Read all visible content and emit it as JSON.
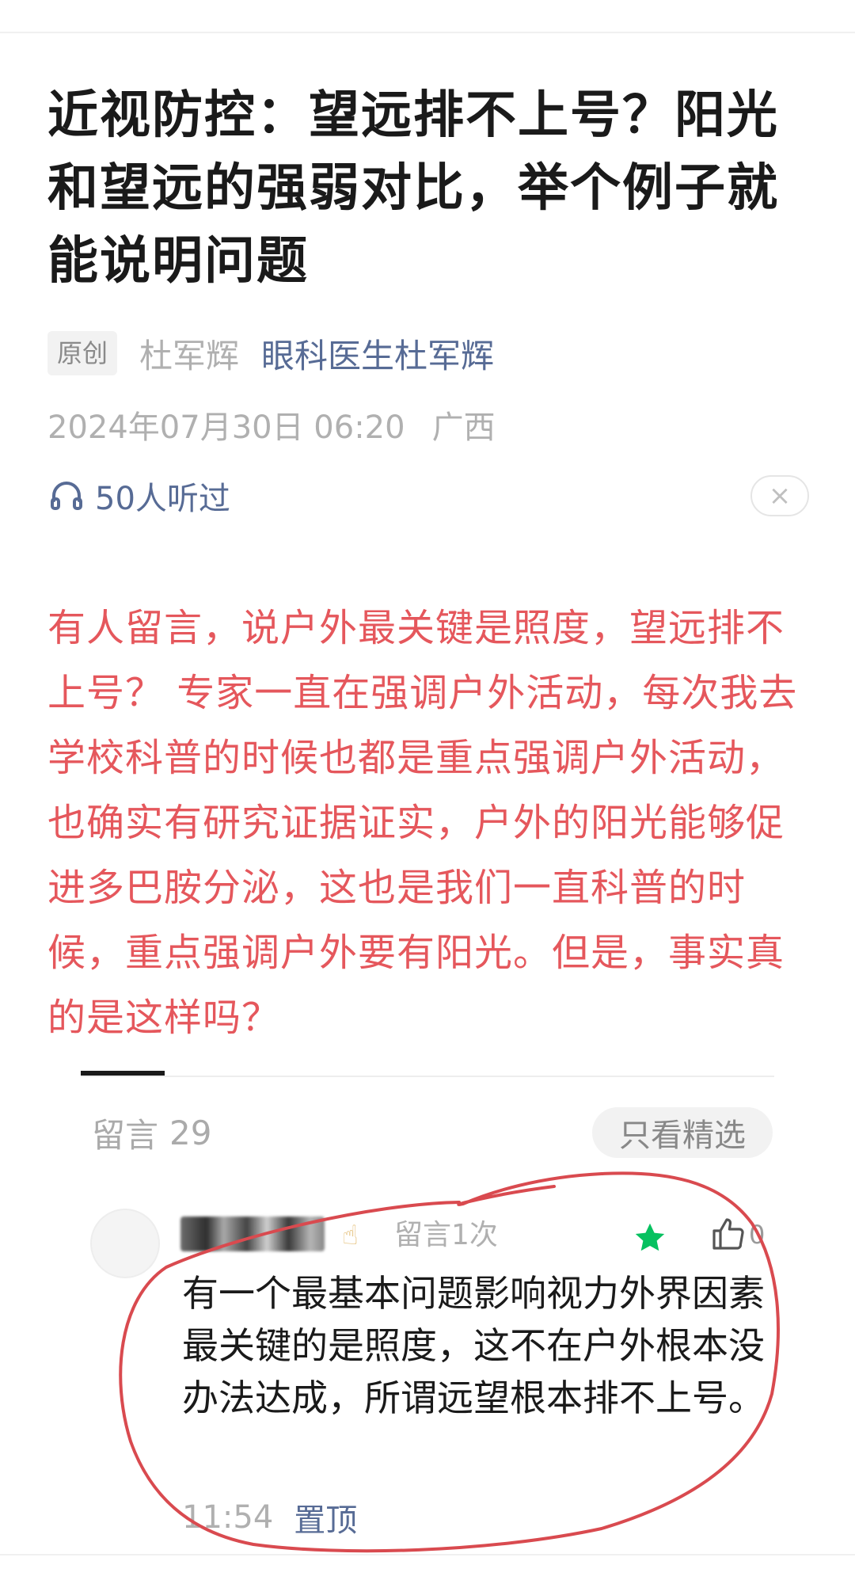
{
  "article": {
    "title": "近视防控：望远排不上号？阳光和望远的强弱对比，举个例子就能说明问题",
    "badge": "原创",
    "author": "杜军辉",
    "account": "眼科医生杜军辉",
    "date": "2024年07月30日 06:20",
    "location": "广西",
    "listen_count": "50人听过",
    "close_symbol": "×",
    "body": "有人留言，说户外最关键是照度，望远排不上号？ 专家一直在强调户外活动，每次我去学校科普的时候也都是重点强调户外活动，也确实有研究证据证实，户外的阳光能够促进多巴胺分泌，这也是我们一直科普的时候，重点强调户外要有阳光。但是，事实真的是这样吗？"
  },
  "comments": {
    "label": "留言",
    "count": "29",
    "filter_label": "只看精选",
    "items": [
      {
        "comment_count_label": "留言1次",
        "likes": "0",
        "text": "有一个最基本问题影响视力外界因素最关键的是照度，这不在户外根本没办法达成，所谓远望根本排不上号。",
        "time": "11:54",
        "action": "置顶"
      }
    ]
  },
  "colors": {
    "accent_link": "#576b95",
    "body_red": "#e5575c",
    "star_green": "#07c160",
    "annotation_red": "#d94a4f"
  },
  "icons": {
    "headphones": "headphones-icon",
    "close": "close-icon",
    "star": "star-icon",
    "like": "thumbs-up-icon"
  }
}
